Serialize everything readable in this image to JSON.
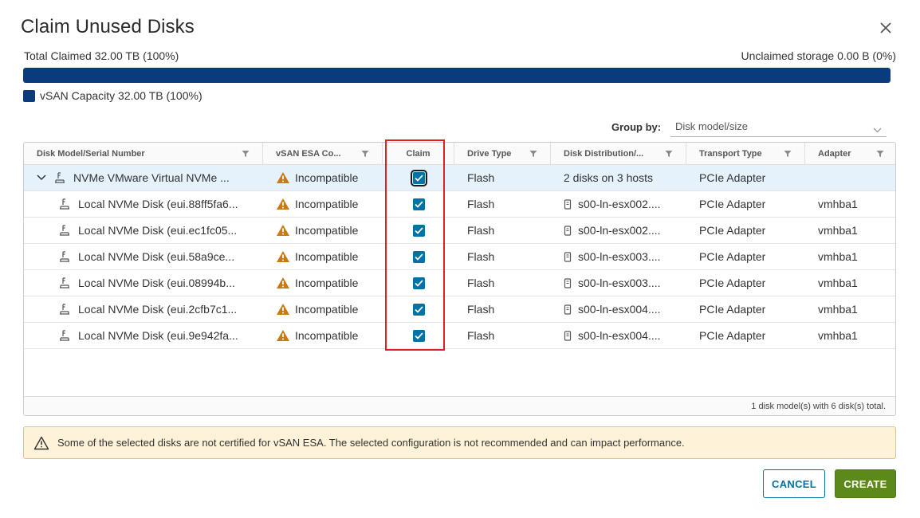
{
  "dialog": {
    "title": "Claim Unused Disks",
    "close_icon": "close-icon"
  },
  "capacity": {
    "claimed_label": "Total Claimed 32.00 TB (100%)",
    "unclaimed_label": "Unclaimed storage 0.00 B (0%)",
    "fill_fraction": 1.0,
    "legend_label": "vSAN Capacity 32.00 TB (100%)",
    "bar_color": "#0a3c7d"
  },
  "group_by": {
    "label": "Group by:",
    "value": "Disk model/size"
  },
  "grid": {
    "columns": [
      {
        "label": "Disk Model/Serial Number"
      },
      {
        "label": "vSAN ESA Co..."
      },
      {
        "label": "Claim"
      },
      {
        "label": "Drive Type"
      },
      {
        "label": "Disk Distribution/..."
      },
      {
        "label": "Transport Type"
      },
      {
        "label": "Adapter"
      }
    ],
    "group_row": {
      "name": "NVMe VMware Virtual NVMe ...",
      "compat": "Incompatible",
      "claimed": true,
      "drive_type": "Flash",
      "distribution": "2 disks on 3 hosts",
      "transport": "PCIe Adapter",
      "adapter": ""
    },
    "rows": [
      {
        "name": "Local NVMe Disk (eui.88ff5fa6...",
        "compat": "Incompatible",
        "claimed": true,
        "drive_type": "Flash",
        "distribution": "s00-ln-esx002....",
        "transport": "PCIe Adapter",
        "adapter": "vmhba1"
      },
      {
        "name": "Local NVMe Disk (eui.ec1fc05...",
        "compat": "Incompatible",
        "claimed": true,
        "drive_type": "Flash",
        "distribution": "s00-ln-esx002....",
        "transport": "PCIe Adapter",
        "adapter": "vmhba1"
      },
      {
        "name": "Local NVMe Disk (eui.58a9ce...",
        "compat": "Incompatible",
        "claimed": true,
        "drive_type": "Flash",
        "distribution": "s00-ln-esx003....",
        "transport": "PCIe Adapter",
        "adapter": "vmhba1"
      },
      {
        "name": "Local NVMe Disk (eui.08994b...",
        "compat": "Incompatible",
        "claimed": true,
        "drive_type": "Flash",
        "distribution": "s00-ln-esx003....",
        "transport": "PCIe Adapter",
        "adapter": "vmhba1"
      },
      {
        "name": "Local NVMe Disk (eui.2cfb7c1...",
        "compat": "Incompatible",
        "claimed": true,
        "drive_type": "Flash",
        "distribution": "s00-ln-esx004....",
        "transport": "PCIe Adapter",
        "adapter": "vmhba1"
      },
      {
        "name": "Local NVMe Disk (eui.9e942fa...",
        "compat": "Incompatible",
        "claimed": true,
        "drive_type": "Flash",
        "distribution": "s00-ln-esx004....",
        "transport": "PCIe Adapter",
        "adapter": "vmhba1"
      }
    ],
    "footer": "1 disk model(s) with 6 disk(s) total."
  },
  "alert": {
    "message": "Some of the selected disks are not certified for vSAN ESA. The selected configuration is not recommended and can impact performance.",
    "icon": "warning-icon"
  },
  "buttons": {
    "cancel": "CANCEL",
    "create": "CREATE"
  }
}
